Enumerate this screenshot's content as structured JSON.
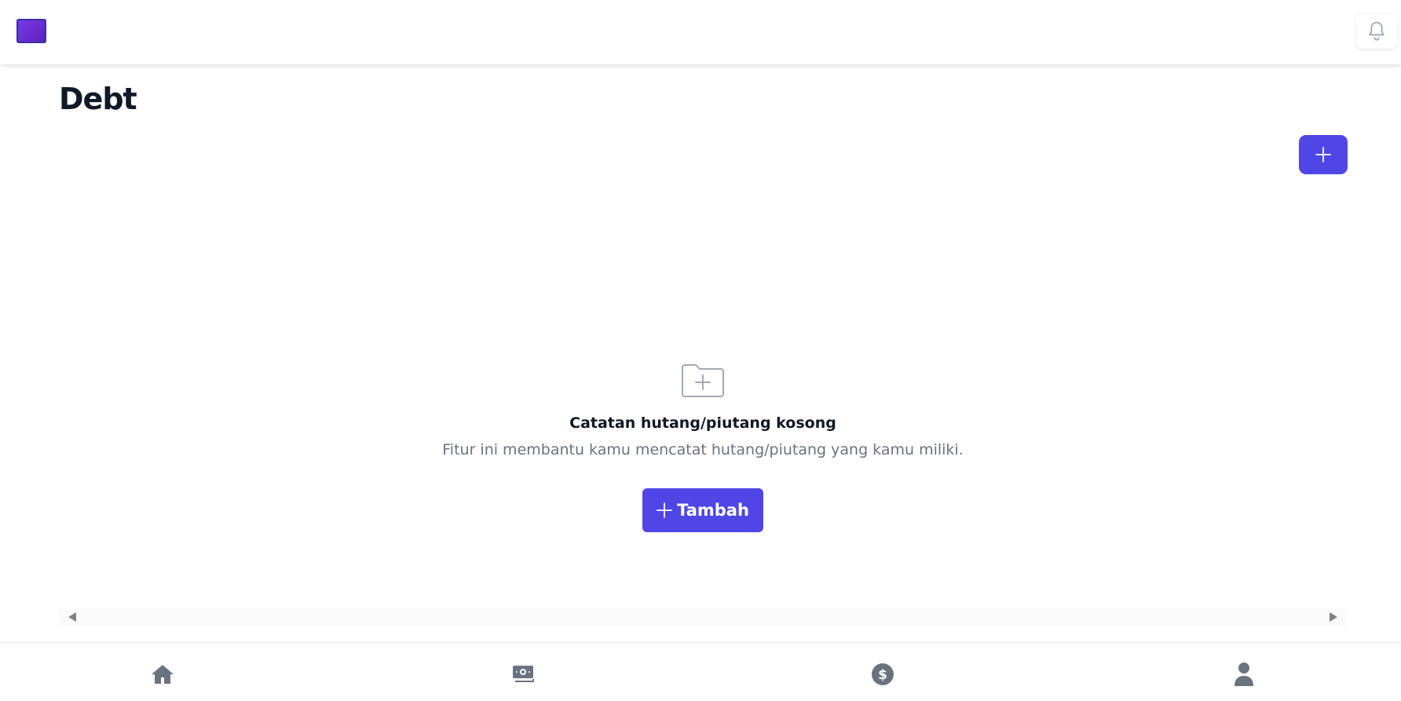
{
  "header": {
    "logo": "app-logo",
    "notification_icon": "bell-icon"
  },
  "page": {
    "title": "Debt",
    "add_icon": "plus-icon"
  },
  "empty_state": {
    "icon": "folder-plus-icon",
    "title": "Catatan hutang/piutang kosong",
    "description": "Fitur ini membantu kamu mencatat hutang/piutang yang kamu miliki.",
    "button_label": "Tambah"
  },
  "scrollbar": {
    "left_icon": "arrow-left-icon",
    "right_icon": "arrow-right-icon"
  },
  "bottom_nav": {
    "items": [
      {
        "icon": "home-icon"
      },
      {
        "icon": "money-icon"
      },
      {
        "icon": "dollar-circle-icon"
      },
      {
        "icon": "user-icon"
      }
    ]
  },
  "colors": {
    "primary": "#4f46e5",
    "nav_icon": "#6b7280",
    "title": "#111827",
    "muted_text": "#6b7280"
  }
}
